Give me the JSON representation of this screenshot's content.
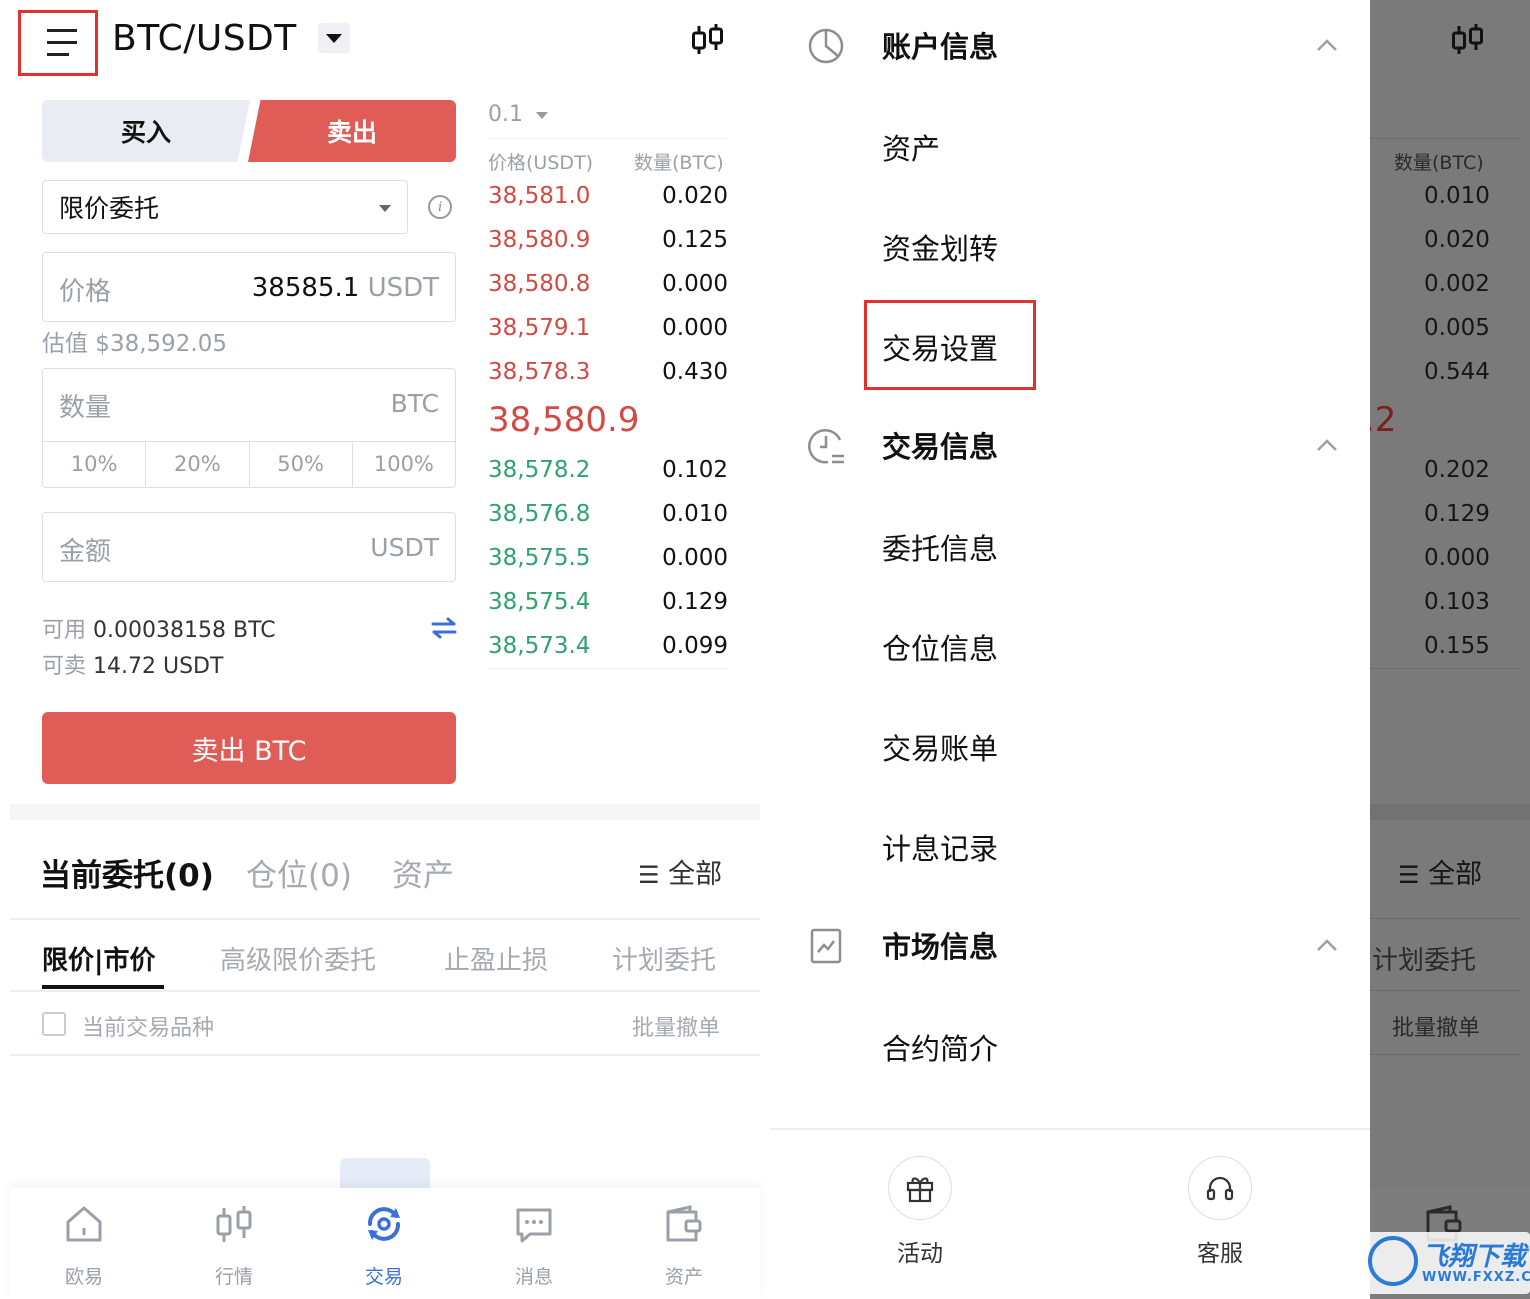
{
  "left": {
    "header": {
      "pair": "BTC/USDT"
    },
    "tabs": {
      "buy": "买入",
      "sell": "卖出"
    },
    "order_type": "限价委托",
    "price": {
      "label": "价格",
      "value": "38585.1",
      "unit": "USDT"
    },
    "estimate": "估值 $38,592.05",
    "quantity": {
      "label": "数量",
      "unit": "BTC",
      "percents": [
        "10%",
        "20%",
        "50%",
        "100%"
      ]
    },
    "amount": {
      "label": "金额",
      "unit": "USDT"
    },
    "available": {
      "label": "可用",
      "value": "0.00038158 BTC"
    },
    "can_sell": {
      "label": "可卖",
      "value": "14.72 USDT"
    },
    "sell_button": "卖出 BTC",
    "orderbook": {
      "step": "0.1",
      "price_header": "价格(USDT)",
      "qty_header": "数量(BTC)",
      "asks": [
        {
          "price": "38,581.0",
          "qty": "0.020"
        },
        {
          "price": "38,580.9",
          "qty": "0.125"
        },
        {
          "price": "38,580.8",
          "qty": "0.000"
        },
        {
          "price": "38,579.1",
          "qty": "0.000"
        },
        {
          "price": "38,578.3",
          "qty": "0.430"
        }
      ],
      "last_price": "38,580.9",
      "bids": [
        {
          "price": "38,578.2",
          "qty": "0.102"
        },
        {
          "price": "38,576.8",
          "qty": "0.010"
        },
        {
          "price": "38,575.5",
          "qty": "0.000"
        },
        {
          "price": "38,575.4",
          "qty": "0.129"
        },
        {
          "price": "38,573.4",
          "qty": "0.099"
        }
      ]
    },
    "order_tabs": {
      "current": "当前委托(0)",
      "positions": "仓位(0)",
      "assets": "资产",
      "filter": "全部"
    },
    "sub_tabs": [
      "限价|市价",
      "高级限价委托",
      "止盈止损",
      "计划委托"
    ],
    "current_pair_only": "当前交易品种",
    "batch_cancel": "批量撤单",
    "bottom_nav": [
      "欧易",
      "行情",
      "交易",
      "消息",
      "资产"
    ]
  },
  "drawer": {
    "sections": [
      {
        "title": "账户信息",
        "items": [
          "资产",
          "资金划转",
          "交易设置"
        ]
      },
      {
        "title": "交易信息",
        "items": [
          "委托信息",
          "仓位信息",
          "交易账单",
          "计息记录"
        ]
      },
      {
        "title": "市场信息",
        "items": [
          "合约简介"
        ]
      }
    ],
    "footer": {
      "activity": "活动",
      "support": "客服"
    }
  },
  "overlay": {
    "qty_header": "数量(BTC)",
    "asks": [
      "0.010",
      "0.020",
      "0.002",
      "0.005",
      "0.544"
    ],
    "price_fragment": ".2",
    "bids": [
      "0.202",
      "0.129",
      "0.000",
      "0.103",
      "0.155"
    ],
    "filter": "全部",
    "sub_tab": "计划委托",
    "batch_cancel": "批量撤单"
  },
  "watermark": {
    "title": "飞翔下载",
    "url": "WWW.FXXZ.COM"
  },
  "colors": {
    "sell_red": "#e05c57",
    "ask_red": "#d24a43",
    "bid_green": "#2fa26d",
    "accent_blue": "#3e6fd8",
    "highlight": "#e0322f"
  }
}
